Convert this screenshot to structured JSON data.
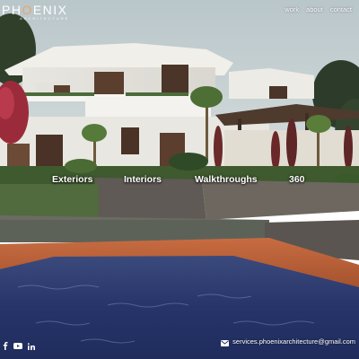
{
  "brand": {
    "name_prefix": "PH",
    "name_accent": "O",
    "name_suffix": "ENIX",
    "tagline": "ARCHITECTURE"
  },
  "nav": {
    "items": [
      "work",
      "about",
      "contact"
    ]
  },
  "categories": [
    "Exteriors",
    "Interiors",
    "Walkthroughs",
    "360"
  ],
  "footer": {
    "email": "services.phoenixarchitecture@gmail.com"
  },
  "social": [
    "facebook-icon",
    "youtube-icon",
    "linkedin-icon"
  ],
  "colors": {
    "text": "#ffffff",
    "pool": "#2a3a6b",
    "deck": "#b8603a",
    "sky": "#c9d3d6"
  }
}
